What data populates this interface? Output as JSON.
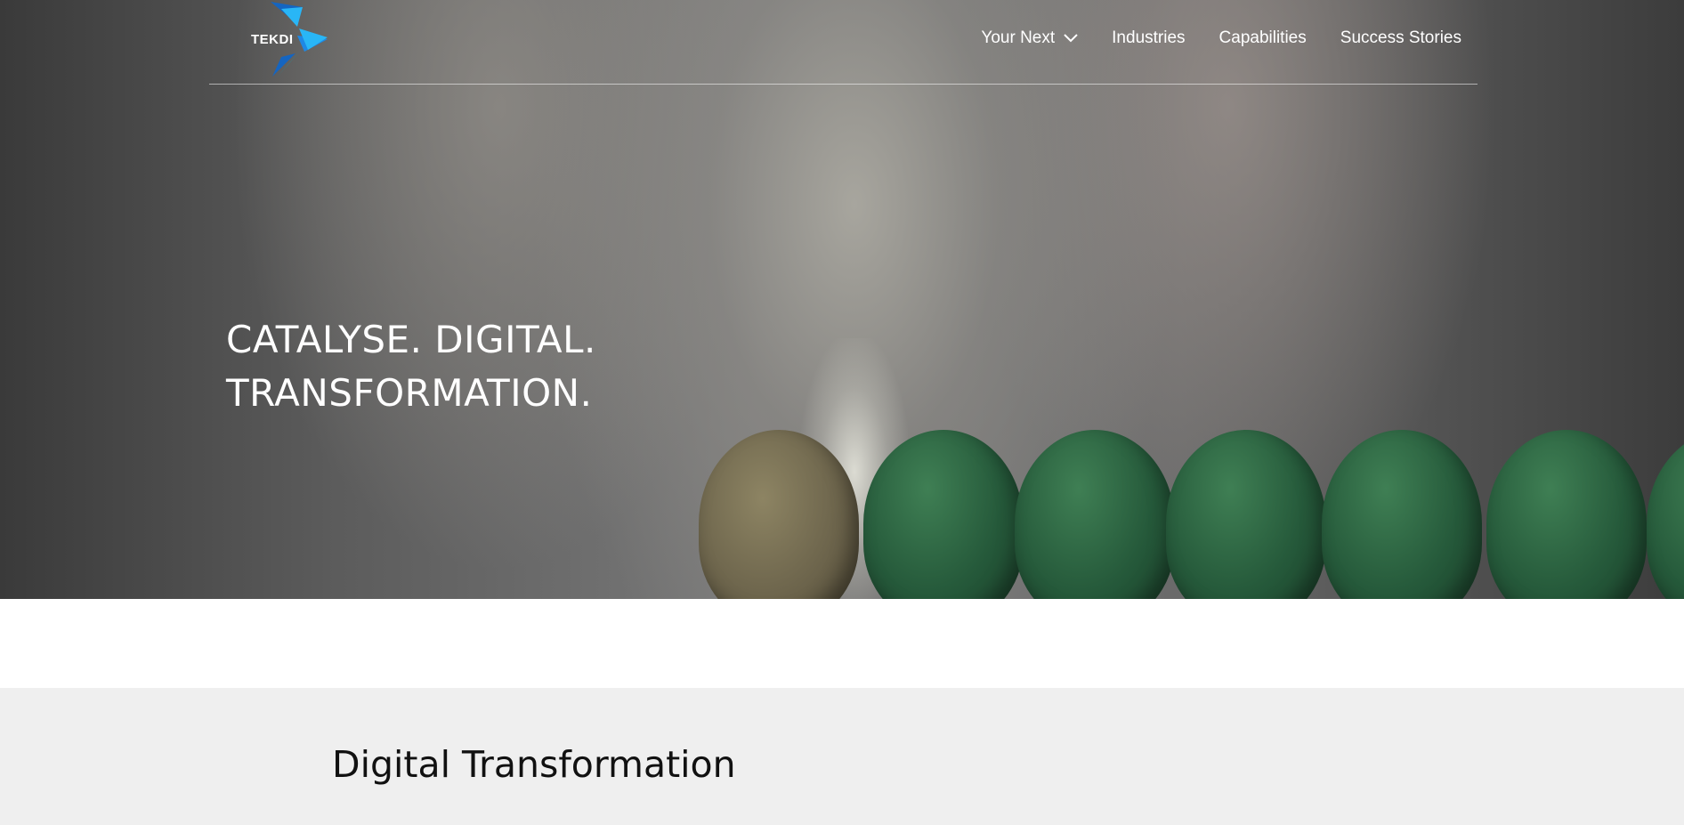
{
  "brand": {
    "logo_text": "TEKDI",
    "colors": {
      "logo_dark_blue": "#1565c0",
      "logo_light_blue": "#29b6f6",
      "logo_teal": "#0aa4b8"
    }
  },
  "nav": {
    "items": [
      {
        "label": "Your Next",
        "has_dropdown": true
      },
      {
        "label": "Industries"
      },
      {
        "label": "Capabilities"
      },
      {
        "label": "Success Stories"
      }
    ]
  },
  "hero": {
    "title_line1": "CATALYSE. DIGITAL.",
    "title_line2": "TRANSFORMATION."
  },
  "section": {
    "title": "Digital Transformation"
  }
}
